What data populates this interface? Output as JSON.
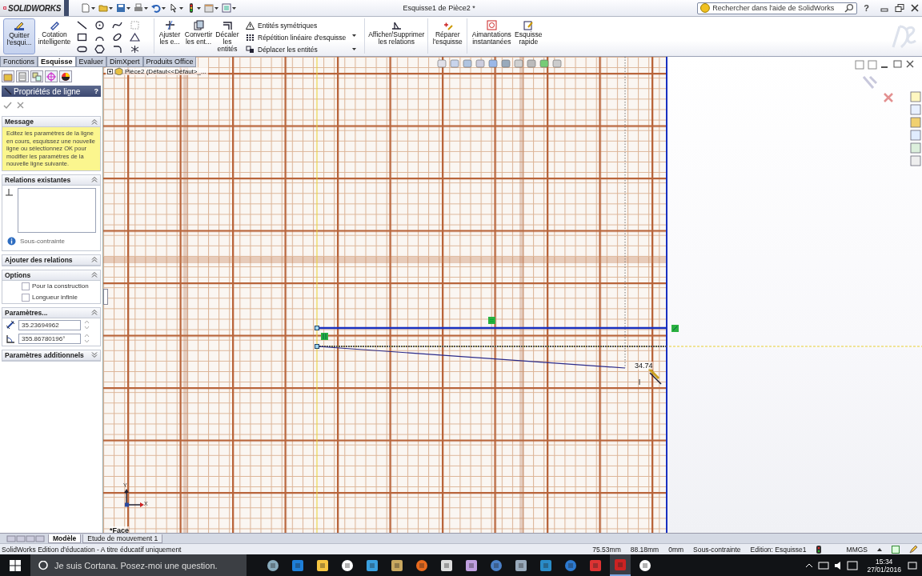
{
  "app": {
    "logo": "SOLIDWORKS",
    "title": "Esquisse1 de Pièce2 *",
    "search_placeholder": "Rechercher dans l'aide de SolidWorks",
    "help": "?"
  },
  "ribbon": {
    "left_buttons": [
      {
        "label": "Quitter l'esqui...",
        "active": true
      },
      {
        "label": "Cotation intelligente",
        "active": false
      }
    ],
    "mid_buttons": [
      {
        "label": "Ajuster les e...",
        "active": false
      },
      {
        "label": "Convertir les ent...",
        "active": false
      },
      {
        "label": "Décaler les entités",
        "active": false
      }
    ],
    "list_commands": [
      "Entités symétriques",
      "Répétition linéaire d'esquisse",
      "Déplacer les entités"
    ],
    "right_buttons": [
      {
        "label": "Afficher/Supprimer les relations",
        "active": false
      },
      {
        "label": "Réparer l'esquisse",
        "active": false
      },
      {
        "label": "Aimantations instantanées",
        "active": false
      },
      {
        "label": "Esquisse rapide",
        "active": false
      }
    ]
  },
  "tabs": [
    {
      "label": "Fonctions",
      "selected": false
    },
    {
      "label": "Esquisse",
      "selected": true
    },
    {
      "label": "Evaluer",
      "selected": false
    },
    {
      "label": "DimXpert",
      "selected": false
    },
    {
      "label": "Produits Office",
      "selected": false
    }
  ],
  "property_manager": {
    "title": "Propriétés de ligne",
    "help": "?",
    "sections": [
      {
        "kind": "message",
        "title": "Message",
        "expanded": true,
        "text": "Editez les paramètres de la ligne en cours, esquissez une nouvelle ligne ou sélectionnez OK pour modifier les paramètres de la nouvelle ligne suivante."
      },
      {
        "kind": "relations",
        "title": "Relations existantes",
        "expanded": true,
        "status": "Sous-contrainte"
      },
      {
        "kind": "plain",
        "title": "Ajouter des relations",
        "expanded": true
      },
      {
        "kind": "options",
        "title": "Options",
        "expanded": true,
        "options": [
          {
            "label": "Pour la construction",
            "checked": false
          },
          {
            "label": "Longueur infinie",
            "checked": false
          }
        ]
      },
      {
        "kind": "parameters",
        "title": "Paramètres...",
        "expanded": true,
        "fields": [
          {
            "value": "35.23694962"
          },
          {
            "value": "355.86780196°"
          }
        ]
      },
      {
        "title": "Paramètres additionnels",
        "expanded": false
      }
    ]
  },
  "graphics": {
    "tree_path": "Pièce2  (Défaut<<Défaut>_...",
    "dimension": "34.74",
    "axis_labels": [
      "Y",
      "X"
    ],
    "view_name": "*Face"
  },
  "bottom_tabs": [
    {
      "label": "Modèle",
      "selected": true
    },
    {
      "label": "Etude de mouvement 1",
      "selected": false
    }
  ],
  "status_bar": {
    "edition": "SolidWorks Edition d'éducation - A titre éducatif uniquement",
    "fields": [
      "75.53mm",
      "88.18mm",
      "0mm",
      "Sous-contrainte",
      "Edition: Esquisse1"
    ],
    "units": "MMGS"
  },
  "taskbar": {
    "search_placeholder": "Je suis Cortana. Posez-moi une question.",
    "time": "15:34",
    "date": "27/01/2016"
  }
}
